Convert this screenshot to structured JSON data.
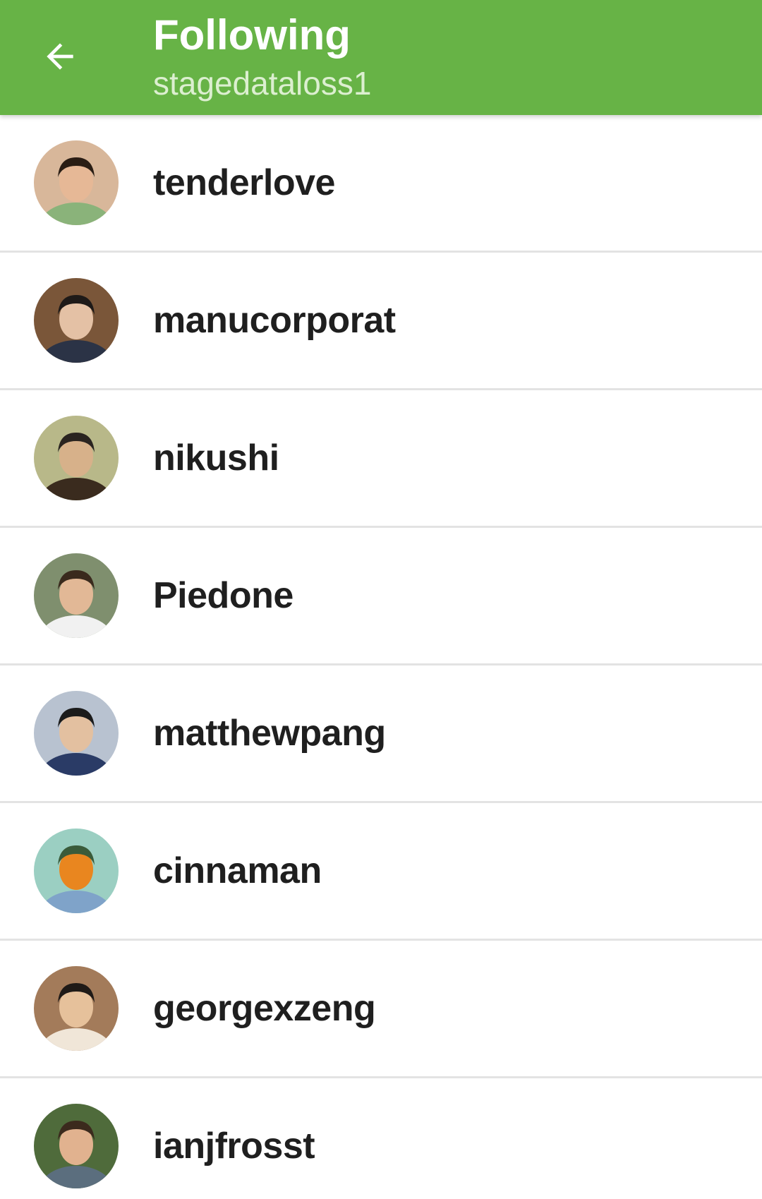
{
  "header": {
    "title": "Following",
    "subtitle": "stagedataloss1",
    "back_icon": "arrow-left-icon",
    "background_color": "#67b346"
  },
  "users": [
    {
      "username": "tenderlove",
      "avatar_bg": "#d8b79a",
      "face": "#e6b896",
      "hair": "#2a1d14",
      "shirt": "#8ab37a"
    },
    {
      "username": "manucorporat",
      "avatar_bg": "#7a5639",
      "face": "#e4c1a5",
      "hair": "#1e1a18",
      "shirt": "#2b3346"
    },
    {
      "username": "nikushi",
      "avatar_bg": "#b8b889",
      "face": "#d7b18a",
      "hair": "#2a2420",
      "shirt": "#3a2b1e"
    },
    {
      "username": "Piedone",
      "avatar_bg": "#7f8f6e",
      "face": "#e2b896",
      "hair": "#3a2a1d",
      "shirt": "#f1f1f1"
    },
    {
      "username": "matthewpang",
      "avatar_bg": "#b8c2d0",
      "face": "#e3c0a0",
      "hair": "#1b1b1b",
      "shirt": "#2a3b66"
    },
    {
      "username": "cinnaman",
      "avatar_bg": "#9bcfc2",
      "face": "#e9861f",
      "hair": "#3a5b3a",
      "shirt": "#7fa3c9"
    },
    {
      "username": "georgexzeng",
      "avatar_bg": "#a37b5a",
      "face": "#e6c19b",
      "hair": "#1f1a17",
      "shirt": "#f0e6d8"
    },
    {
      "username": "ianjfrosst",
      "avatar_bg": "#4f6b3b",
      "face": "#e1b28f",
      "hair": "#3b2a1d",
      "shirt": "#5b6e7e"
    }
  ]
}
